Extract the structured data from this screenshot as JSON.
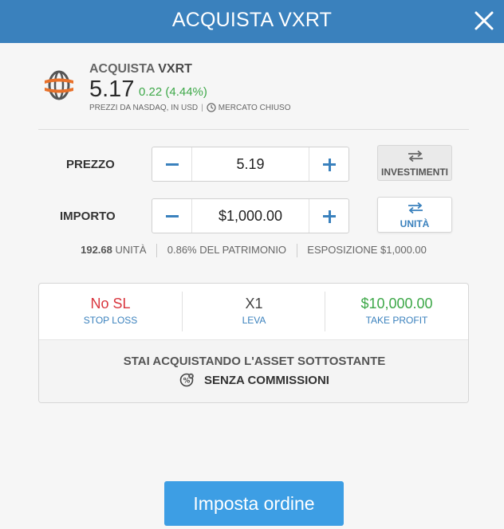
{
  "header": {
    "title": "ACQUISTA VXRT"
  },
  "asset": {
    "action": "ACQUISTA",
    "symbol": "VXRT",
    "price": "5.17",
    "change": "0.22 (4.44%)",
    "source": "PREZZI DA NASDAQ, IN USD",
    "market_status": "MERCATO CHIUSO"
  },
  "price_row": {
    "label": "PREZZO",
    "value": "5.19",
    "toggle_label": "INVESTIMENTI"
  },
  "amount_row": {
    "label": "IMPORTO",
    "value": "$1,000.00",
    "toggle_label": "UNITÀ"
  },
  "summary": {
    "units_value": "192.68",
    "units_label": "UNITÀ",
    "equity": "0.86% DEL PATRIMONIO",
    "exposure": "ESPOSIZIONE $1,000.00"
  },
  "trade_settings": {
    "stop_loss": {
      "value": "No SL",
      "label": "STOP LOSS"
    },
    "leverage": {
      "value": "X1",
      "label": "LEVA"
    },
    "take_profit": {
      "value": "$10,000.00",
      "label": "TAKE PROFIT"
    }
  },
  "notice": {
    "line1": "STAI ACQUISTANDO L'ASSET SOTTOSTANTE",
    "line2": "SENZA COMMISSIONI"
  },
  "order_button": {
    "label": "Imposta ordine"
  },
  "colors": {
    "header": "#3a81bd",
    "accent": "#3a81bd",
    "positive": "#3da848",
    "negative": "#d9363e",
    "button": "#3d9ee4",
    "logo": "#e8712a"
  },
  "icons": {
    "close": "close-icon",
    "logo": "globe-logo-icon",
    "clock": "clock-icon",
    "switch": "swap-arrows-icon",
    "fee": "no-commission-icon"
  }
}
